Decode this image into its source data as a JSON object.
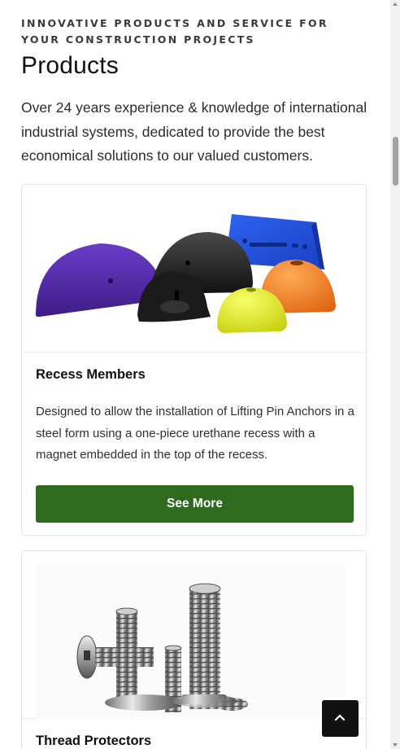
{
  "header": {
    "eyebrow": "INNOVATIVE PRODUCTS AND SERVICE FOR YOUR CONSTRUCTION PROJECTS",
    "title": "Products",
    "intro": "Over 24 years experience & knowledge of international industrial systems, dedicated to provide the best economical solutions to our valued customers."
  },
  "products": [
    {
      "title": "Recess Members",
      "description": "Designed to allow the installation of Lifting Pin Anchors in a steel form using a one-piece urethane recess with a magnet embedded in the top of the recess.",
      "button_label": "See More"
    },
    {
      "title": "Thread Protectors"
    }
  ],
  "colors": {
    "button": "#2e6b1f",
    "back_to_top": "#111111"
  },
  "icons": {
    "back_to_top": "chevron-up-icon"
  }
}
